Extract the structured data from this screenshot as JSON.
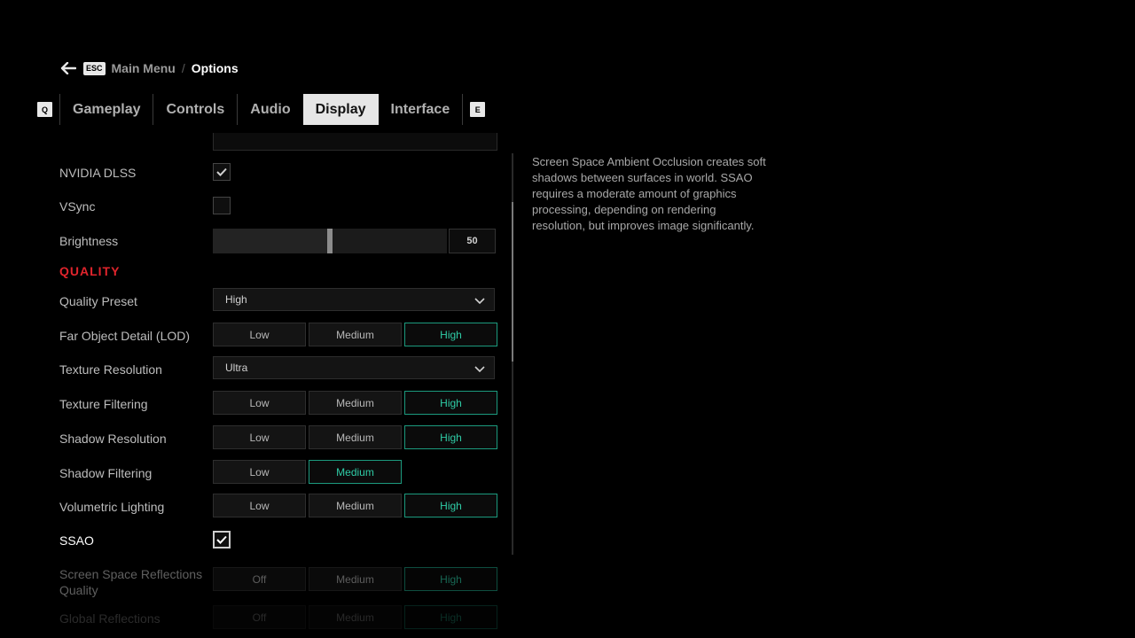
{
  "breadcrumb": {
    "key": "ESC",
    "parent": "Main Menu",
    "separator": "/",
    "current": "Options"
  },
  "tabs": {
    "prev_key": "Q",
    "next_key": "E",
    "items": [
      {
        "label": "Gameplay"
      },
      {
        "label": "Controls"
      },
      {
        "label": "Audio"
      },
      {
        "label": "Display",
        "active": true
      },
      {
        "label": "Interface"
      }
    ]
  },
  "settings": {
    "dlss": {
      "label": "NVIDIA DLSS",
      "checked": true
    },
    "vsync": {
      "label": "VSync",
      "checked": false
    },
    "brightness": {
      "label": "Brightness",
      "value": "50",
      "level_percent": 50
    },
    "quality_header": "QUALITY",
    "quality_preset": {
      "label": "Quality Preset",
      "value": "High"
    },
    "far_object_detail": {
      "label": "Far Object Detail (LOD)",
      "options": [
        "Low",
        "Medium",
        "High"
      ],
      "selected": "High"
    },
    "texture_resolution": {
      "label": "Texture Resolution",
      "value": "Ultra"
    },
    "texture_filtering": {
      "label": "Texture Filtering",
      "options": [
        "Low",
        "Medium",
        "High"
      ],
      "selected": "High"
    },
    "shadow_resolution": {
      "label": "Shadow Resolution",
      "options": [
        "Low",
        "Medium",
        "High"
      ],
      "selected": "High"
    },
    "shadow_filtering": {
      "label": "Shadow Filtering",
      "options": [
        "Low",
        "Medium"
      ],
      "selected": "Medium"
    },
    "volumetric_lighting": {
      "label": "Volumetric Lighting",
      "options": [
        "Low",
        "Medium",
        "High"
      ],
      "selected": "High"
    },
    "ssao": {
      "label": "SSAO",
      "checked": true
    },
    "ssr_quality": {
      "label_line1": "Screen Space Reflections",
      "label_line2": "Quality",
      "options": [
        "Off",
        "Medium",
        "High"
      ],
      "selected": "High"
    },
    "global_reflections": {
      "label": "Global Reflections",
      "options": [
        "Off",
        "Medium",
        "High"
      ],
      "selected": "High"
    }
  },
  "description": "Screen Space Ambient Occlusion creates soft shadows between surfaces in world. SSAO requires a moderate amount of graphics processing, depending on rendering resolution, but improves image significantly.",
  "colors": {
    "accent": "#2fcca6",
    "section_header": "#e0242c",
    "background": "#000000"
  }
}
